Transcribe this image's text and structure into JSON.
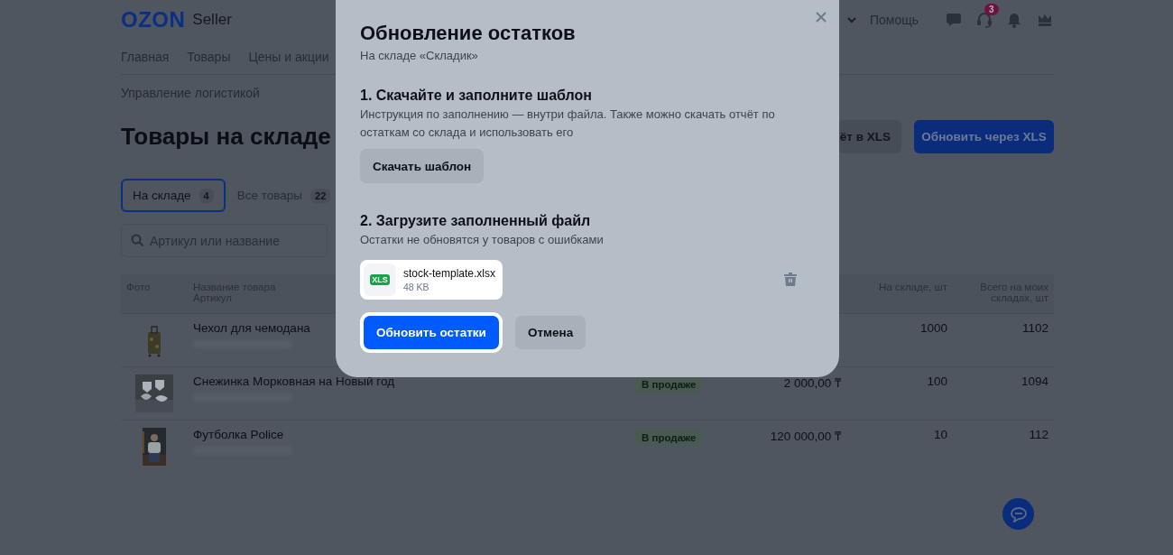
{
  "header": {
    "logo": "OZON",
    "logo_suffix": "Seller",
    "help": "Помощь",
    "support_badge": "3",
    "nav": [
      "Главная",
      "Товары",
      "Цены и акции"
    ]
  },
  "breadcrumb": "Управление логистикой",
  "page_title": "Товары на складе",
  "actions": [
    {
      "label": "ёт в XLS",
      "kind": "secondary"
    },
    {
      "label": "Обновить через XLS",
      "kind": "primary"
    }
  ],
  "tabs": [
    {
      "label": "На складе",
      "count": "4",
      "selected": true
    },
    {
      "label": "Все товары",
      "count": "22",
      "selected": false
    }
  ],
  "search": {
    "placeholder": "Артикул или название"
  },
  "table": {
    "columns": {
      "photo": "Фото",
      "name": "Название товара",
      "sku": "Артикул",
      "stock": "На складе, шт",
      "total": "Всего на моих складах, шт"
    },
    "rows": [
      {
        "name": "Чехол для чемодана",
        "status": null,
        "price": null,
        "stock": "1000",
        "total": "1102"
      },
      {
        "name": "Снежинка Морковная на Новый год",
        "status": "В продаже",
        "price": "2 000,00 ₸",
        "stock": "100",
        "total": "1094"
      },
      {
        "name": "Футболка Police",
        "status": "В продаже",
        "price": "120 000,00 ₸",
        "stock": "10",
        "total": "112"
      }
    ]
  },
  "modal": {
    "title": "Обновление остатков",
    "subtitle": "На складе «Складик»",
    "step1": {
      "heading": "1. Скачайте и заполните шаблон",
      "text": "Инструкция по заполнению — внутри файла. Также можно скачать отчёт по остаткам со склада и использовать его",
      "button": "Скачать шаблон"
    },
    "step2": {
      "heading": "2. Загрузите заполненный файл",
      "text": "Остатки не обновятся у товаров с ошибками"
    },
    "file": {
      "type": "XLS",
      "name": "stock-template.xlsx",
      "size": "48 KB",
      "highlighted": true
    },
    "buttons": [
      {
        "label": "Обновить остатки",
        "kind": "primary",
        "highlighted": true
      },
      {
        "label": "Отмена",
        "kind": "secondary",
        "highlighted": false
      }
    ]
  }
}
